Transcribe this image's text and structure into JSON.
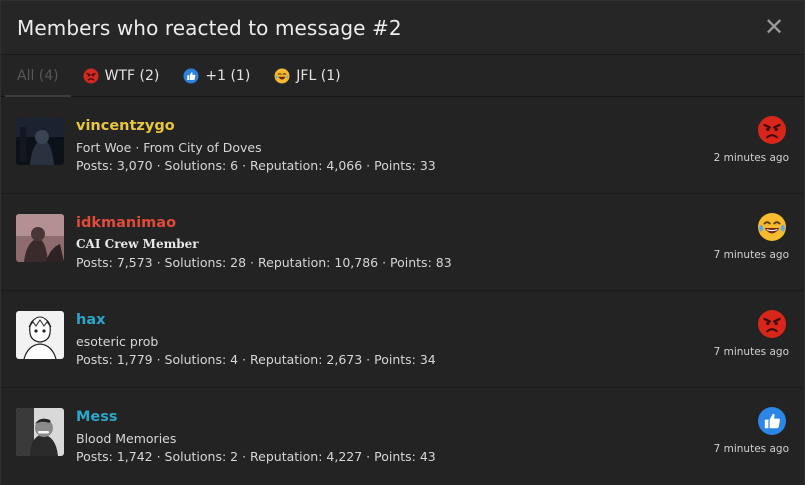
{
  "dialog": {
    "title": "Members who reacted to message #2",
    "close_symbol": "✕"
  },
  "tabs": [
    {
      "label": "All (4)",
      "icon": null
    },
    {
      "label": "WTF (2)",
      "icon": "angry-face-icon"
    },
    {
      "label": "+1 (1)",
      "icon": "thumbs-up-icon"
    },
    {
      "label": "JFL (1)",
      "icon": "crying-laughing-face-icon"
    }
  ],
  "members": [
    {
      "username": "vincentzygo",
      "name_color": "#e8c73a",
      "user_title": "Fort Woe · From City of Doves",
      "stats": "Posts: 3,070 · Solutions: 6 · Reputation: 4,066 · Points: 33",
      "reaction_icon": "angry-face-icon",
      "time": "2 minutes ago"
    },
    {
      "username": "idkmanimao",
      "name_color": "#e24a3a",
      "user_title": "CAI Crew Member",
      "stats": "Posts: 7,573 · Solutions: 28 · Reputation: 10,786 · Points: 83",
      "reaction_icon": "crying-laughing-face-icon",
      "time": "7 minutes ago"
    },
    {
      "username": "hax",
      "name_color": "#2aa7c9",
      "user_title": "esoteric prob",
      "stats": "Posts: 1,779 · Solutions: 4 · Reputation: 2,673 · Points: 34",
      "reaction_icon": "angry-face-icon",
      "time": "7 minutes ago"
    },
    {
      "username": "Mess",
      "name_color": "#2aa7c9",
      "user_title": "Blood Memories",
      "stats": "Posts: 1,742 · Solutions: 2 · Reputation: 4,227 · Points: 43",
      "reaction_icon": "thumbs-up-icon",
      "time": "7 minutes ago"
    }
  ]
}
